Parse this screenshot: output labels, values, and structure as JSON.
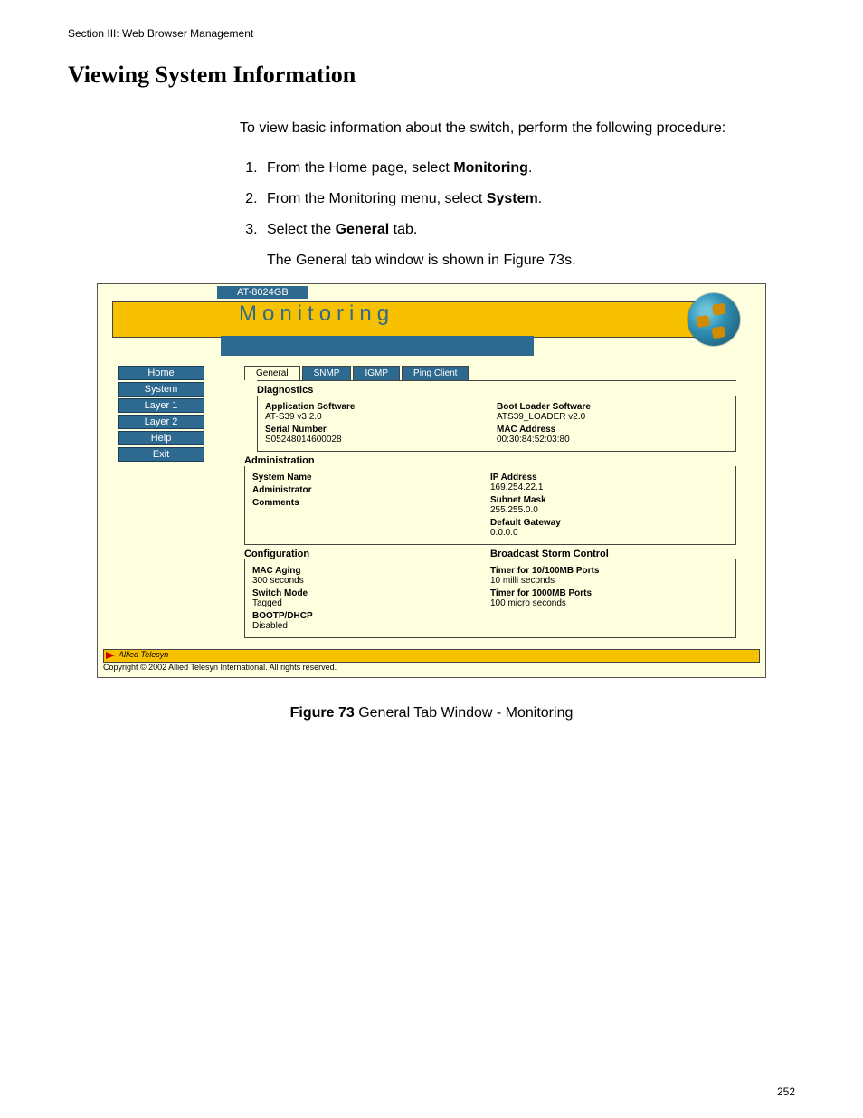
{
  "section_header": "Section III: Web Browser Management",
  "main_heading": "Viewing System Information",
  "intro": "To view basic information about the switch, perform the following procedure:",
  "steps": [
    {
      "pre": "From the Home page, select ",
      "bold": "Monitoring",
      "post": "."
    },
    {
      "pre": "From the Monitoring menu, select ",
      "bold": "System",
      "post": "."
    },
    {
      "pre": "Select the ",
      "bold": "General",
      "post": " tab."
    }
  ],
  "sub_after_step3": "The General tab window is shown in Figure 73s.",
  "figure": {
    "model": "AT-8024GB",
    "banner_title": "Monitoring",
    "nav": [
      "Home",
      "System",
      "Layer 1",
      "Layer 2",
      "Help",
      "Exit"
    ],
    "tabs": [
      "General",
      "SNMP",
      "IGMP",
      "Ping Client"
    ],
    "diagnostics": {
      "title": "Diagnostics",
      "left": [
        {
          "lbl": "Application Software",
          "val": "AT-S39 v3.2.0"
        },
        {
          "lbl": "Serial Number",
          "val": "S05248014600028"
        }
      ],
      "right": [
        {
          "lbl": "Boot Loader Software",
          "val": "ATS39_LOADER v2.0"
        },
        {
          "lbl": "MAC Address",
          "val": "00:30:84:52:03:80"
        }
      ]
    },
    "administration": {
      "title": "Administration",
      "left": [
        {
          "lbl": "System Name",
          "val": ""
        },
        {
          "lbl": "Administrator",
          "val": ""
        },
        {
          "lbl": "Comments",
          "val": ""
        }
      ],
      "right": [
        {
          "lbl": "IP Address",
          "val": "169.254.22.1"
        },
        {
          "lbl": "Subnet Mask",
          "val": "255.255.0.0"
        },
        {
          "lbl": "Default Gateway",
          "val": "0.0.0.0"
        }
      ]
    },
    "configuration": {
      "title_left": "Configuration",
      "title_right": "Broadcast Storm Control",
      "left": [
        {
          "lbl": "MAC Aging",
          "val": "300 seconds"
        },
        {
          "lbl": "Switch Mode",
          "val": "Tagged"
        },
        {
          "lbl": "BOOTP/DHCP",
          "val": "Disabled"
        }
      ],
      "right": [
        {
          "lbl": "Timer for 10/100MB Ports",
          "val": "10 milli seconds"
        },
        {
          "lbl": "Timer for 1000MB Ports",
          "val": "100 micro seconds"
        }
      ]
    },
    "brand": "Allied Telesyn",
    "copyright": "Copyright © 2002 Allied Telesyn International. All rights reserved."
  },
  "figure_caption_bold": "Figure 73",
  "figure_caption_rest": "  General Tab Window - Monitoring",
  "page_number": "252"
}
